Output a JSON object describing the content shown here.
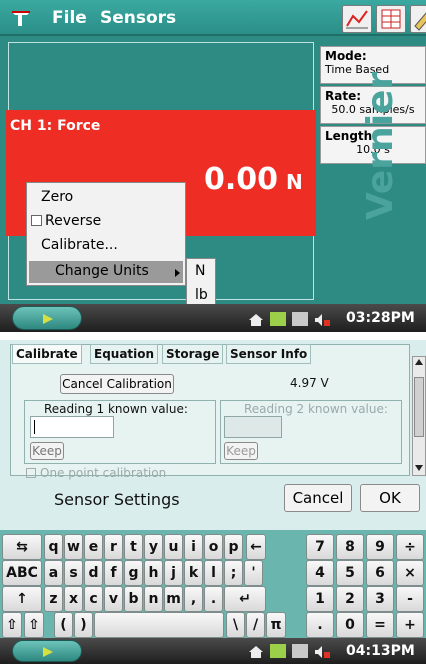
{
  "screen1": {
    "menubar": {
      "file": "File",
      "sensors": "Sensors"
    },
    "info": {
      "mode_label": "Mode:",
      "mode_value": "Time Based",
      "rate_label": "Rate:",
      "rate_value": "50.0 samples/s",
      "length_label": "Length:",
      "length_value": "10.0 s"
    },
    "channel": {
      "title": "CH 1: Force",
      "value": "0.00",
      "unit": "N"
    },
    "context_menu": {
      "zero": "Zero",
      "reverse": "Reverse",
      "calibrate": "Calibrate...",
      "change_units": "Change Units"
    },
    "units_submenu": {
      "option1": "N",
      "option2": "lb"
    },
    "brand_watermark": "Vernier",
    "taskbar": {
      "time": "03:28PM"
    }
  },
  "screen2": {
    "tabs": [
      "Calibrate",
      "Equation",
      "Storage",
      "Sensor Info"
    ],
    "cancel_calibration": "Cancel Calibration",
    "voltage": "4.97 V",
    "reading1_label": "Reading 1 known value:",
    "reading2_label": "Reading 2 known value:",
    "keep1": "Keep",
    "keep2": "Keep",
    "one_point": "One point calibration",
    "dialog_title": "Sensor Settings",
    "cancel_button": "Cancel",
    "ok_button": "OK",
    "keyboard": {
      "row1": [
        "q",
        "w",
        "e",
        "r",
        "t",
        "y",
        "u",
        "i",
        "o",
        "p"
      ],
      "row2": [
        "a",
        "s",
        "d",
        "f",
        "g",
        "h",
        "j",
        "k",
        "l",
        ";",
        "'"
      ],
      "row3": [
        "z",
        "x",
        "c",
        "v",
        "b",
        "n",
        "m",
        ",",
        "."
      ],
      "abc": "ABC",
      "paren_open": "(",
      "paren_close": ")",
      "backslash": "\\",
      "slash": "/",
      "pi": "π",
      "num1": [
        "7",
        "8",
        "9",
        "÷"
      ],
      "num2": [
        "4",
        "5",
        "6",
        "×"
      ],
      "num3": [
        "1",
        "2",
        "3",
        "-"
      ],
      "num4": [
        ".",
        "0",
        "=",
        "+"
      ]
    },
    "taskbar": {
      "time": "04:13PM"
    }
  },
  "colors": {
    "teal": "#2e8b84",
    "red_panel": "#ee2d24",
    "light_teal": "#d9eeec"
  }
}
